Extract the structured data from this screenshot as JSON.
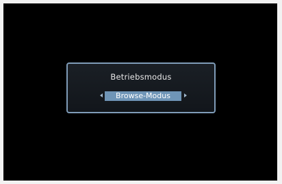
{
  "dialog": {
    "title": "Betriebsmodus",
    "selected_value": "Browse-Modus"
  },
  "icons": {
    "prev": "triangle-left-icon",
    "next": "triangle-right-icon"
  },
  "colors": {
    "screen_background": "#000000",
    "dialog_border": "#7f9cb8",
    "selection_highlight": "#6f95b7",
    "text": "#e8e8e8"
  }
}
